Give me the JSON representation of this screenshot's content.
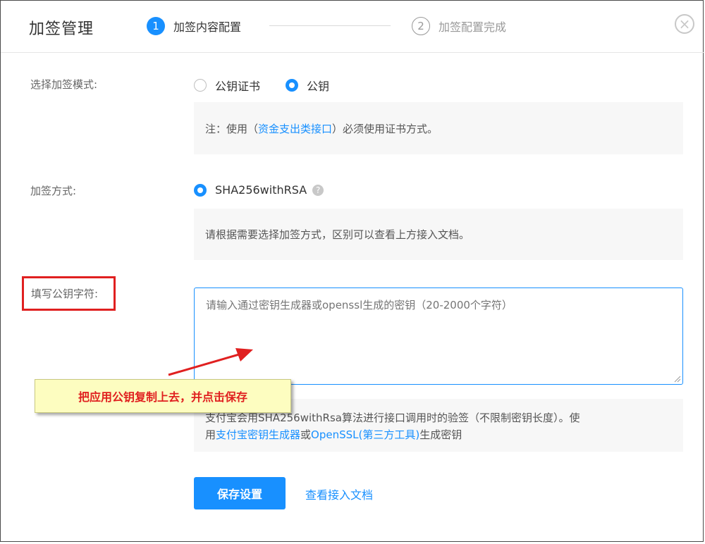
{
  "header": {
    "title": "加签管理",
    "steps": [
      {
        "number": "1",
        "label": "加签内容配置",
        "state": "active"
      },
      {
        "number": "2",
        "label": "加签配置完成",
        "state": "inactive"
      }
    ],
    "close_symbol": "×"
  },
  "mode": {
    "label": "选择加签模式:",
    "options": [
      {
        "label": "公钥证书",
        "checked": false
      },
      {
        "label": "公钥",
        "checked": true
      }
    ],
    "note_prefix": "注：使用（",
    "note_link": "资金支出类接口",
    "note_suffix": "）必须使用证书方式。"
  },
  "method": {
    "label": "加签方式:",
    "option": "SHA256withRSA",
    "help_symbol": "?",
    "note": "请根据需要选择加签方式，区别可以查看上方接入文档。"
  },
  "public_key": {
    "label": "填写公钥字符:",
    "placeholder": "请输入通过密钥生成器或openssl生成的密钥（20-2000个字符）",
    "value": ""
  },
  "callout": {
    "text": "把应用公钥复制上去，并点击保存"
  },
  "key_note": {
    "line1": "支付宝会用SHA256withRsa算法进行接口调用时的验签（不限制密钥长度）。使",
    "line2_prefix": "用",
    "link1": "支付宝密钥生成器",
    "middle": "或",
    "link2": "OpenSSL(第三方工具)",
    "line2_suffix": "生成密钥"
  },
  "actions": {
    "save_label": "保存设置",
    "doc_link": "查看接入文档"
  },
  "colors": {
    "accent": "#1890ff",
    "annotation_red": "#e02020",
    "callout_bg": "#fdfdc0"
  }
}
